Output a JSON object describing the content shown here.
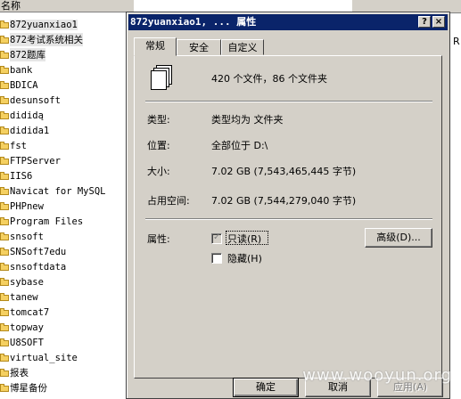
{
  "explorer": {
    "column_name": "名称",
    "right_truncated": "R",
    "items": [
      {
        "name": "872yuanxiao1",
        "selected": true
      },
      {
        "name": "872考试系统相关",
        "selected": true
      },
      {
        "name": "872题库",
        "selected": true
      },
      {
        "name": "bank"
      },
      {
        "name": "BDICA"
      },
      {
        "name": "desunsoft"
      },
      {
        "name": "dididą"
      },
      {
        "name": "didida1"
      },
      {
        "name": "fst"
      },
      {
        "name": "FTPServer"
      },
      {
        "name": "IIS6"
      },
      {
        "name": "Navicat for MySQL"
      },
      {
        "name": "PHPnew"
      },
      {
        "name": "Program Files"
      },
      {
        "name": "snsoft"
      },
      {
        "name": "SNSoft7edu"
      },
      {
        "name": "snsoftdata"
      },
      {
        "name": "sybase"
      },
      {
        "name": "tanew"
      },
      {
        "name": "tomcat7"
      },
      {
        "name": "topway"
      },
      {
        "name": "U8SOFT"
      },
      {
        "name": "virtual_site"
      },
      {
        "name": "报表"
      },
      {
        "name": "博星备份"
      }
    ]
  },
  "dialog": {
    "title": "872yuanxiao1, ... 属性",
    "help_button": "?",
    "close_button": "×",
    "tabs": [
      {
        "label": "常规",
        "active": true
      },
      {
        "label": "安全"
      },
      {
        "label": "自定义"
      }
    ],
    "summary": "420 个文件，86 个文件夹",
    "fields": {
      "type_label": "类型:",
      "type_value": "类型均为 文件夹",
      "location_label": "位置:",
      "location_value": "全部位于 D:\\",
      "size_label": "大小:",
      "size_value": "7.02 GB (7,543,465,445 字节)",
      "size_on_disk_label": "占用空间:",
      "size_on_disk_value": "7.02 GB (7,544,279,040 字节)"
    },
    "attributes": {
      "label": "属性:",
      "readonly_label": "只读(R)",
      "readonly_checked": true,
      "hidden_label": "隐藏(H)",
      "hidden_checked": false,
      "advanced_button": "高级(D)..."
    },
    "buttons": {
      "ok": "确定",
      "cancel": "取消",
      "apply": "应用(A)"
    }
  },
  "watermark": "www.wooyun.org",
  "colors": {
    "titlebar": "#0a246a",
    "face": "#d4d0c8",
    "folder": "#f5d061"
  }
}
